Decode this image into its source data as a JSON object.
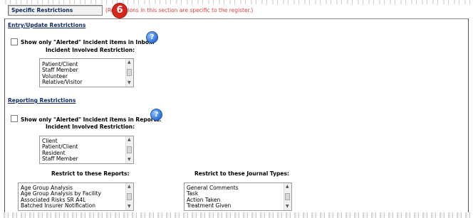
{
  "header": {
    "section_label": "Specific Restrictions",
    "note": "(Restrictions in this section are specific to the register.)",
    "callout_number": "6"
  },
  "entry": {
    "section_title": "Entry/Update Restrictions",
    "checkbox_label": "Show only \"Alerted\" Incident items in Inbox.",
    "restriction_label": "Incident Involved Restriction:",
    "options": [
      "Patient/Client",
      "Staff Member",
      "Volunteer",
      "Relative/Visitor"
    ]
  },
  "reporting": {
    "section_title": "Reporting Restrictions",
    "checkbox_label": "Show only \"Alerted\" Incident items in Reports.",
    "restriction_label": "Incident Involved Restriction:",
    "options": [
      "Client",
      "Patient/Client",
      "Resident",
      "Staff Member"
    ]
  },
  "reports": {
    "label": "Restrict to these Reports:",
    "options": [
      "Age Group Analysis",
      "Age Group Analysis by Facility",
      "Associated Risks SR A4L",
      "Batched Insurer Notification"
    ]
  },
  "journal": {
    "label": "Restrict to these Journal Types:",
    "options": [
      "General Comments",
      "Task",
      "Action Taken",
      "Treatment Given"
    ]
  },
  "icons": {
    "help": "help-icon",
    "scroll_up": "chevron-up-icon",
    "scroll_down": "chevron-down-icon"
  },
  "colors": {
    "note": "#e0403a",
    "callout": "#d9261c",
    "section_title": "#102a63"
  }
}
